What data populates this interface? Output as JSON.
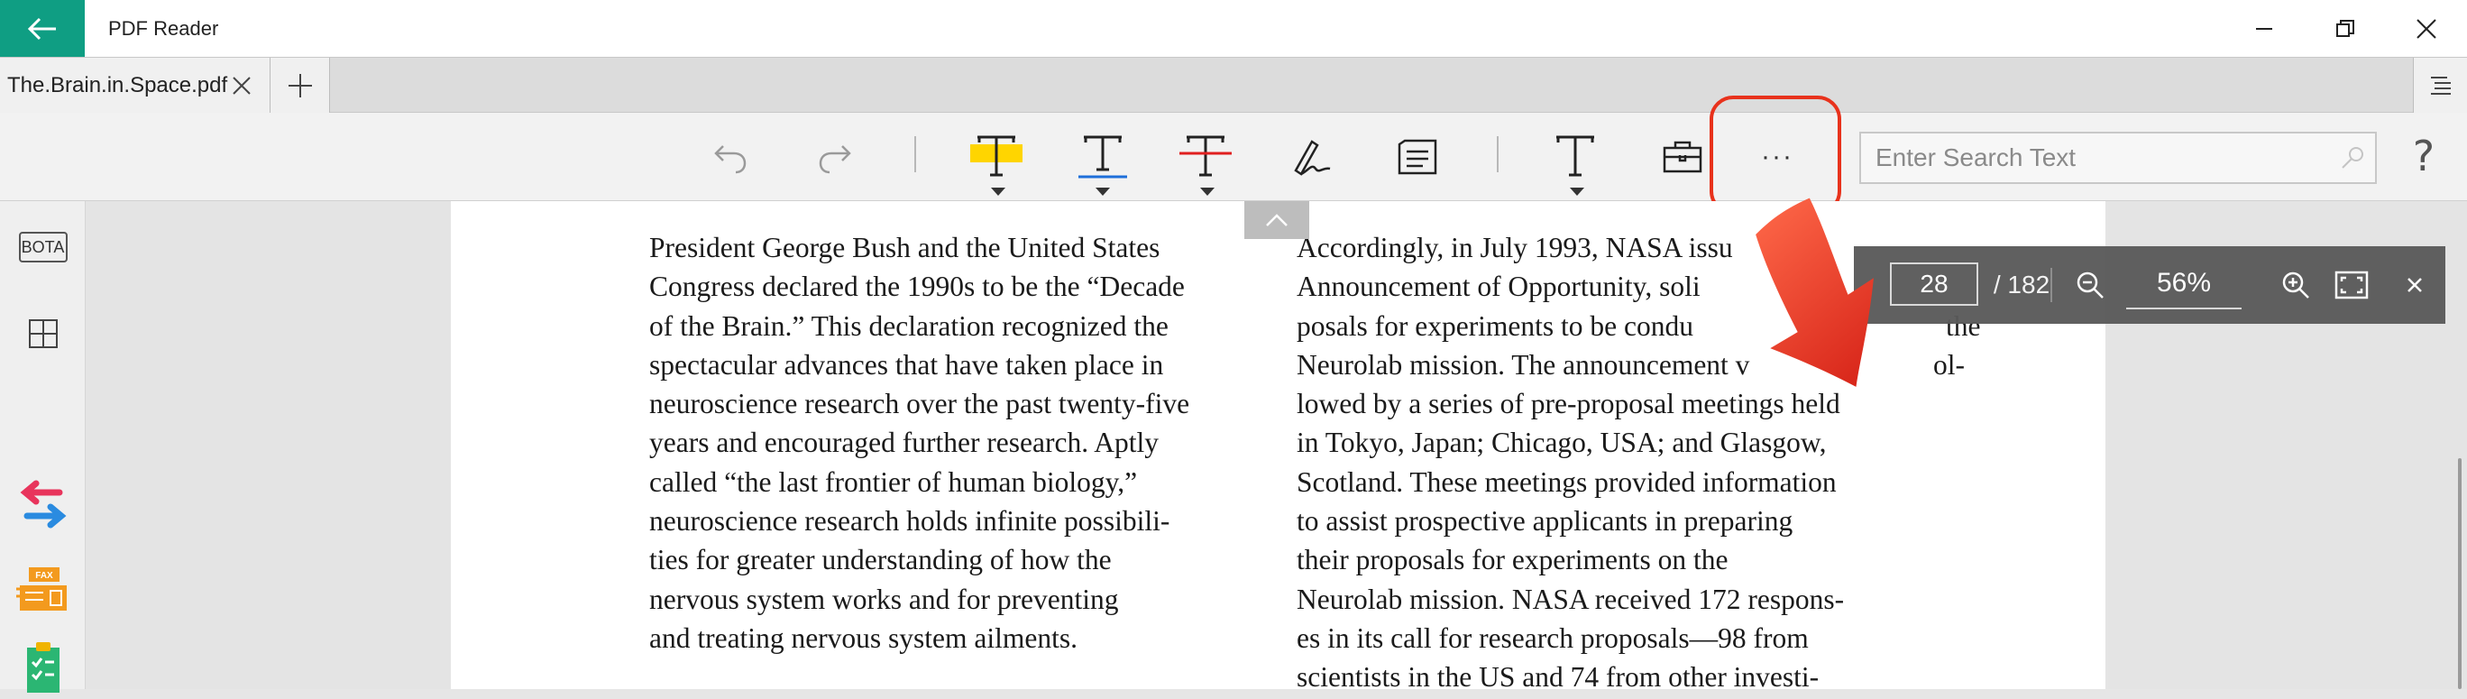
{
  "window": {
    "title": "PDF Reader",
    "controls": [
      "minimize",
      "restore",
      "close"
    ]
  },
  "tabs": [
    {
      "label": "The.Brain.in.Space.pdf",
      "active": true
    }
  ],
  "toolbar": {
    "buttons": [
      "undo-icon",
      "redo-icon",
      "highlight-text-icon",
      "underline-text-icon",
      "strikethrough-text-icon",
      "ink-signature-icon",
      "note-icon",
      "text-box-icon",
      "toolbox-icon",
      "more-icon"
    ],
    "more_label": "···",
    "highlight_color": "#ffd500",
    "underline_color": "#1e6fd9",
    "strikethrough_color": "#e02020",
    "search": {
      "placeholder": "Enter Search Text",
      "value": ""
    },
    "help_label": "?"
  },
  "sidebar": {
    "bota_label": "BOTA",
    "items": [
      "bota-icon",
      "thumbnails-icon",
      "convert-icon",
      "fax-icon",
      "form-checklist-icon"
    ],
    "fax_label": "FAX"
  },
  "document": {
    "left_column": [
      "President George Bush and the United States",
      "Congress declared the 1990s to be the “Decade",
      "of the Brain.” This declaration recognized the",
      "spectacular advances that have taken place in",
      "neuroscience research over the past twenty-five",
      "years and encouraged further research. Aptly",
      "called “the last frontier of human biology,”",
      "neuroscience research holds infinite possibili-",
      "ties for greater understanding of how the",
      "nervous system works and for preventing",
      "and treating nervous system ailments."
    ],
    "right_column": [
      "Accordingly, in July 1993, NASA issu",
      "Announcement of Opportunity, soli",
      "posals for experiments to be condu",
      "Neurolab mission. The announcement v",
      "lowed by a series of pre-proposal meetings held",
      "in Tokyo, Japan; Chicago, USA; and Glasgow,",
      "Scotland. These meetings provided information",
      "to assist prospective applicants in preparing",
      "their proposals for experiments on the",
      "Neurolab mission. NASA received 172 respons-",
      "es in its call for research proposals—98 from",
      "scientists in the US and 74 from other investi-"
    ],
    "right_fragments": {
      "line3_tail": "the",
      "line4_tail": "ol-"
    }
  },
  "page_nav": {
    "current_page": "28",
    "total_pages": "/ 182",
    "zoom": "56%"
  },
  "colors": {
    "accent": "#0f9e83",
    "pointer": "#e8321c"
  }
}
